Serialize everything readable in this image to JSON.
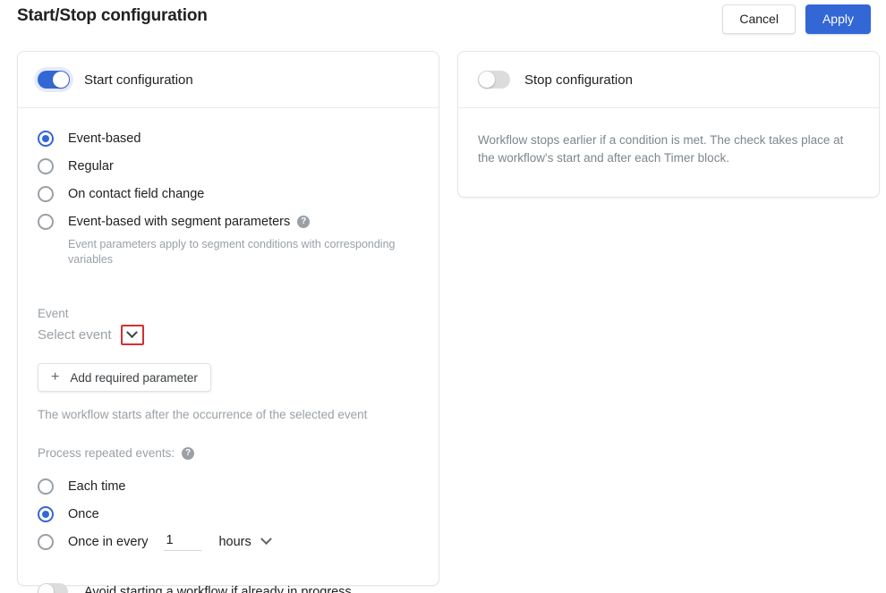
{
  "header": {
    "title": "Start/Stop configuration",
    "cancel_label": "Cancel",
    "apply_label": "Apply"
  },
  "start_card": {
    "toggle_label": "Start configuration",
    "toggle_state": "on",
    "trigger_options": [
      {
        "label": "Event-based",
        "selected": true
      },
      {
        "label": "Regular",
        "selected": false
      },
      {
        "label": "On contact field change",
        "selected": false
      },
      {
        "label": "Event-based with segment parameters",
        "selected": false,
        "help": "?"
      }
    ],
    "segment_hint": "Event parameters apply to segment conditions with corresponding variables",
    "event_label": "Event",
    "event_placeholder": "Select event",
    "add_parameter_label": "Add required parameter",
    "add_parameter_icon": "+",
    "workflow_note": "The workflow starts after the occurrence of the selected event",
    "repeat_label": "Process repeated events:",
    "repeat_help": "?",
    "repeat_options": [
      {
        "label": "Each time",
        "selected": false
      },
      {
        "label": "Once",
        "selected": true
      },
      {
        "label": "Once in every",
        "selected": false
      }
    ],
    "interval_value": "1",
    "interval_unit": "hours",
    "avoid_label": "Avoid starting a workflow if already in progress",
    "avoid_state": "off"
  },
  "stop_card": {
    "toggle_label": "Stop configuration",
    "toggle_state": "off",
    "description": "Workflow stops earlier if a condition is met. The check takes place at the workflow's start and after each Timer block."
  },
  "colors": {
    "accent": "#3367d6",
    "highlight": "#d3302f",
    "muted": "#9aa0a6"
  }
}
